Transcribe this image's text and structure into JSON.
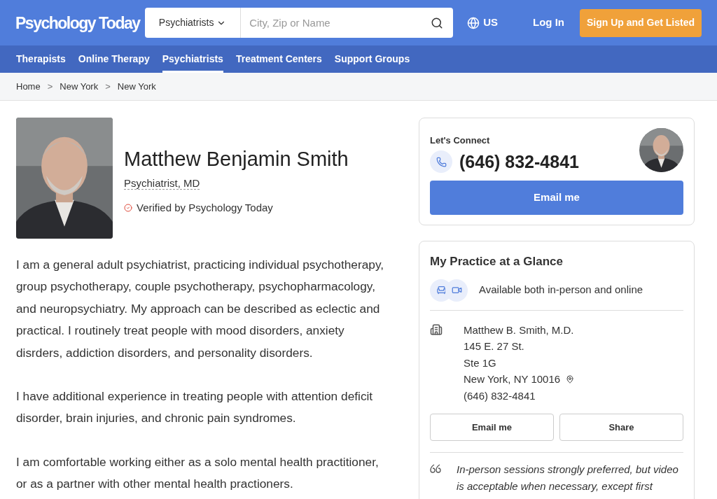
{
  "header": {
    "logo": "Psychology Today",
    "search_category": "Psychiatrists",
    "search": {
      "placeholder": "City, Zip or Name"
    },
    "region": "US",
    "login": "Log In",
    "signup": "Sign Up and Get Listed"
  },
  "nav": [
    {
      "label": "Therapists",
      "selected": false
    },
    {
      "label": "Online Therapy",
      "selected": false
    },
    {
      "label": "Psychiatrists",
      "selected": true
    },
    {
      "label": "Treatment Centers",
      "selected": false
    },
    {
      "label": "Support Groups",
      "selected": false
    }
  ],
  "breadcrumbs": [
    {
      "label": "Home"
    },
    {
      "separator": ">",
      "label": "New York"
    },
    {
      "separator": ">",
      "label": "New York"
    }
  ],
  "profile": {
    "name": "Matthew Benjamin Smith",
    "title": "Psychiatrist, MD",
    "verified": "Verified by Psychology Today"
  },
  "paragraphs": [
    "I am a general adult psychiatrist, practicing individual psychotherapy, group psychotherapy, couple psychotherapy, psychopharmacology, and neuropsychiatry. My approach can be described as eclectic and practical. I routinely treat people with mood disorders, anxiety disrders, addiction disorders, and personality disorders.",
    "I have additional experience in treating people with attention deficit disorder, brain injuries, and chronic pain syndromes.",
    "I am comfortable working either as a solo mental health practitioner, or as a partner with other mental health practioners."
  ],
  "connect": {
    "label": "Let's Connect",
    "phone": "(646) 832-4841",
    "button": "Email me"
  },
  "glance": {
    "title": "My Practice at a Glance",
    "availability": "Available both in-person and online",
    "address_lines": [
      "Matthew B. Smith, M.D.",
      "145 E. 27 St.",
      "Ste 1G",
      "New York, NY 10016"
    ],
    "phone": "(646) 832-4841",
    "buttons": [
      "Email me",
      "Share"
    ],
    "quote": "In-person sessions strongly preferred, but video is acceptable when necessary, except first"
  }
}
